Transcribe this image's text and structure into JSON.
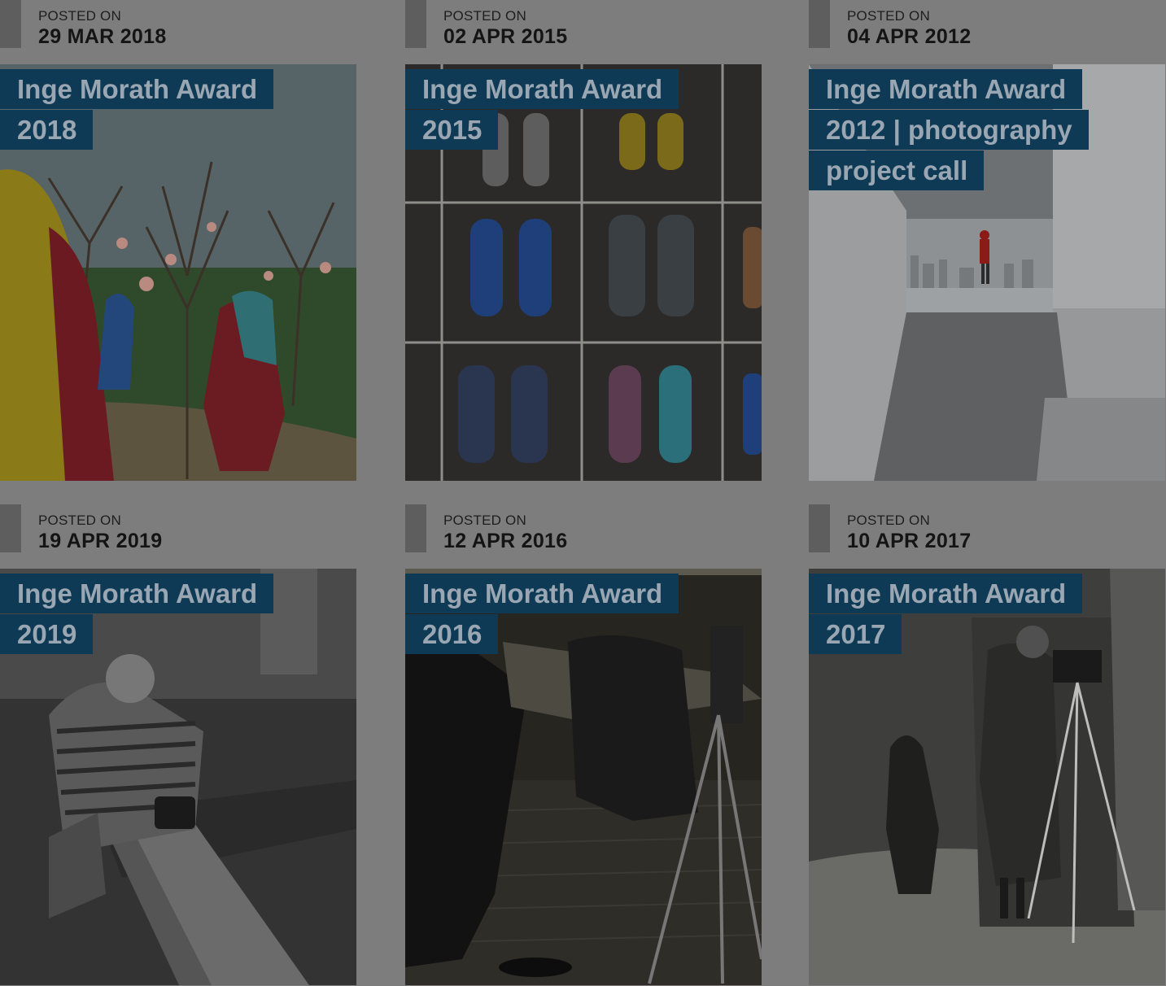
{
  "posts": [
    {
      "posted_label": "POSTED ON",
      "date": "29 MAR 2018",
      "title": "Inge Morath Award 2018",
      "image_icon": "photo-orchard-women"
    },
    {
      "posted_label": "POSTED ON",
      "date": "02 APR 2015",
      "title": "Inge Morath Award 2015",
      "image_icon": "photo-shoes-grid"
    },
    {
      "posted_label": "POSTED ON",
      "date": "04 APR 2012",
      "title": "Inge Morath Award 2012 | photography project call",
      "image_icon": "photo-rooftop-child"
    },
    {
      "posted_label": "POSTED ON",
      "date": "19 APR 2019",
      "title": "Inge Morath Award 2019",
      "image_icon": "photo-photographer-bench"
    },
    {
      "posted_label": "POSTED ON",
      "date": "12 APR 2016",
      "title": "Inge Morath Award 2016",
      "image_icon": "photo-tripod-camera"
    },
    {
      "posted_label": "POSTED ON",
      "date": "10 APR 2017",
      "title": "Inge Morath Award 2017",
      "image_icon": "photo-photographer-shadow"
    }
  ],
  "colors": {
    "page_bg": "#7d7d7d",
    "title_bg": "#0e3a56",
    "title_text": "#9aa7b3",
    "meta_bar": "#5e5e5e"
  }
}
